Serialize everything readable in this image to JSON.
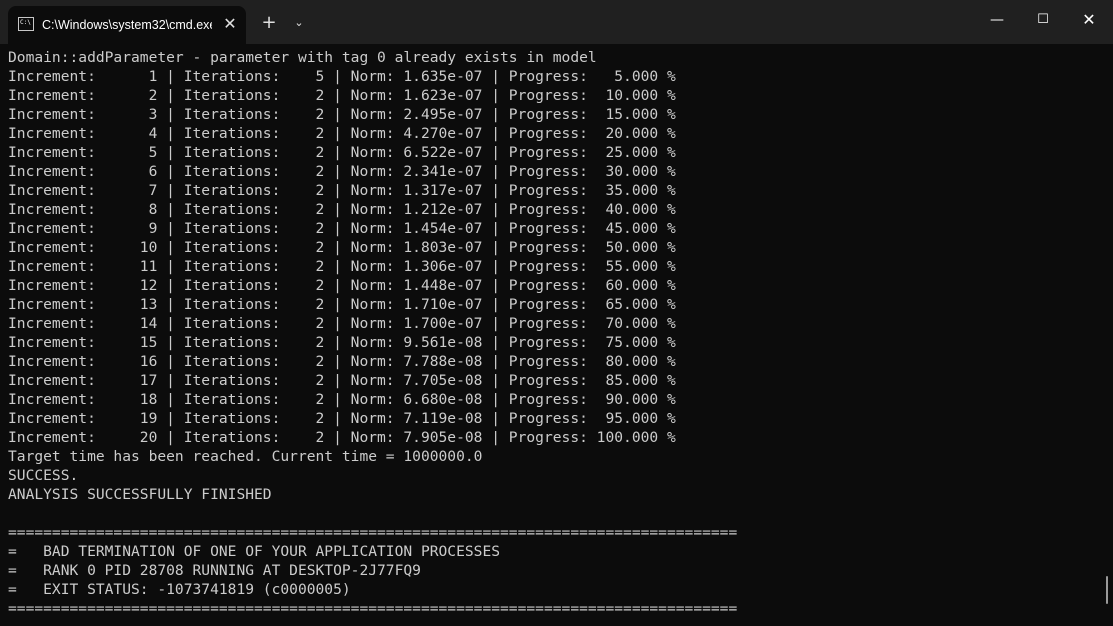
{
  "window": {
    "tab_title": "C:\\Windows\\system32\\cmd.exe",
    "tab_icon_text": "C:\\",
    "tab_close_glyph": "✕",
    "new_tab_glyph": "+",
    "dropdown_glyph": "⌄",
    "minimize_glyph": "—",
    "maximize_glyph": "☐",
    "close_glyph": "✕",
    "icons": [
      "terminal-icon",
      "close-icon",
      "plus-icon",
      "chevron-down-icon",
      "minimize-icon",
      "maximize-icon",
      "close-icon"
    ]
  },
  "terminal": {
    "lines": [
      "Domain::addParameter - parameter with tag 0 already exists in model",
      "Increment:      1 | Iterations:    5 | Norm: 1.635e-07 | Progress:   5.000 %",
      "Increment:      2 | Iterations:    2 | Norm: 1.623e-07 | Progress:  10.000 %",
      "Increment:      3 | Iterations:    2 | Norm: 2.495e-07 | Progress:  15.000 %",
      "Increment:      4 | Iterations:    2 | Norm: 4.270e-07 | Progress:  20.000 %",
      "Increment:      5 | Iterations:    2 | Norm: 6.522e-07 | Progress:  25.000 %",
      "Increment:      6 | Iterations:    2 | Norm: 2.341e-07 | Progress:  30.000 %",
      "Increment:      7 | Iterations:    2 | Norm: 1.317e-07 | Progress:  35.000 %",
      "Increment:      8 | Iterations:    2 | Norm: 1.212e-07 | Progress:  40.000 %",
      "Increment:      9 | Iterations:    2 | Norm: 1.454e-07 | Progress:  45.000 %",
      "Increment:     10 | Iterations:    2 | Norm: 1.803e-07 | Progress:  50.000 %",
      "Increment:     11 | Iterations:    2 | Norm: 1.306e-07 | Progress:  55.000 %",
      "Increment:     12 | Iterations:    2 | Norm: 1.448e-07 | Progress:  60.000 %",
      "Increment:     13 | Iterations:    2 | Norm: 1.710e-07 | Progress:  65.000 %",
      "Increment:     14 | Iterations:    2 | Norm: 1.700e-07 | Progress:  70.000 %",
      "Increment:     15 | Iterations:    2 | Norm: 9.561e-08 | Progress:  75.000 %",
      "Increment:     16 | Iterations:    2 | Norm: 7.788e-08 | Progress:  80.000 %",
      "Increment:     17 | Iterations:    2 | Norm: 7.705e-08 | Progress:  85.000 %",
      "Increment:     18 | Iterations:    2 | Norm: 6.680e-08 | Progress:  90.000 %",
      "Increment:     19 | Iterations:    2 | Norm: 7.119e-08 | Progress:  95.000 %",
      "Increment:     20 | Iterations:    2 | Norm: 7.905e-08 | Progress: 100.000 %",
      "Target time has been reached. Current time = 1000000.0",
      "SUCCESS.",
      "ANALYSIS SUCCESSFULLY FINISHED",
      "",
      "===================================================================================",
      "=   BAD TERMINATION OF ONE OF YOUR APPLICATION PROCESSES",
      "=   RANK 0 PID 28708 RUNNING AT DESKTOP-2J77FQ9",
      "=   EXIT STATUS: -1073741819 (c0000005)",
      "==================================================================================="
    ]
  },
  "colors": {
    "background": "#0c0c0c",
    "titlebar": "#202020",
    "text": "#cccccc"
  }
}
